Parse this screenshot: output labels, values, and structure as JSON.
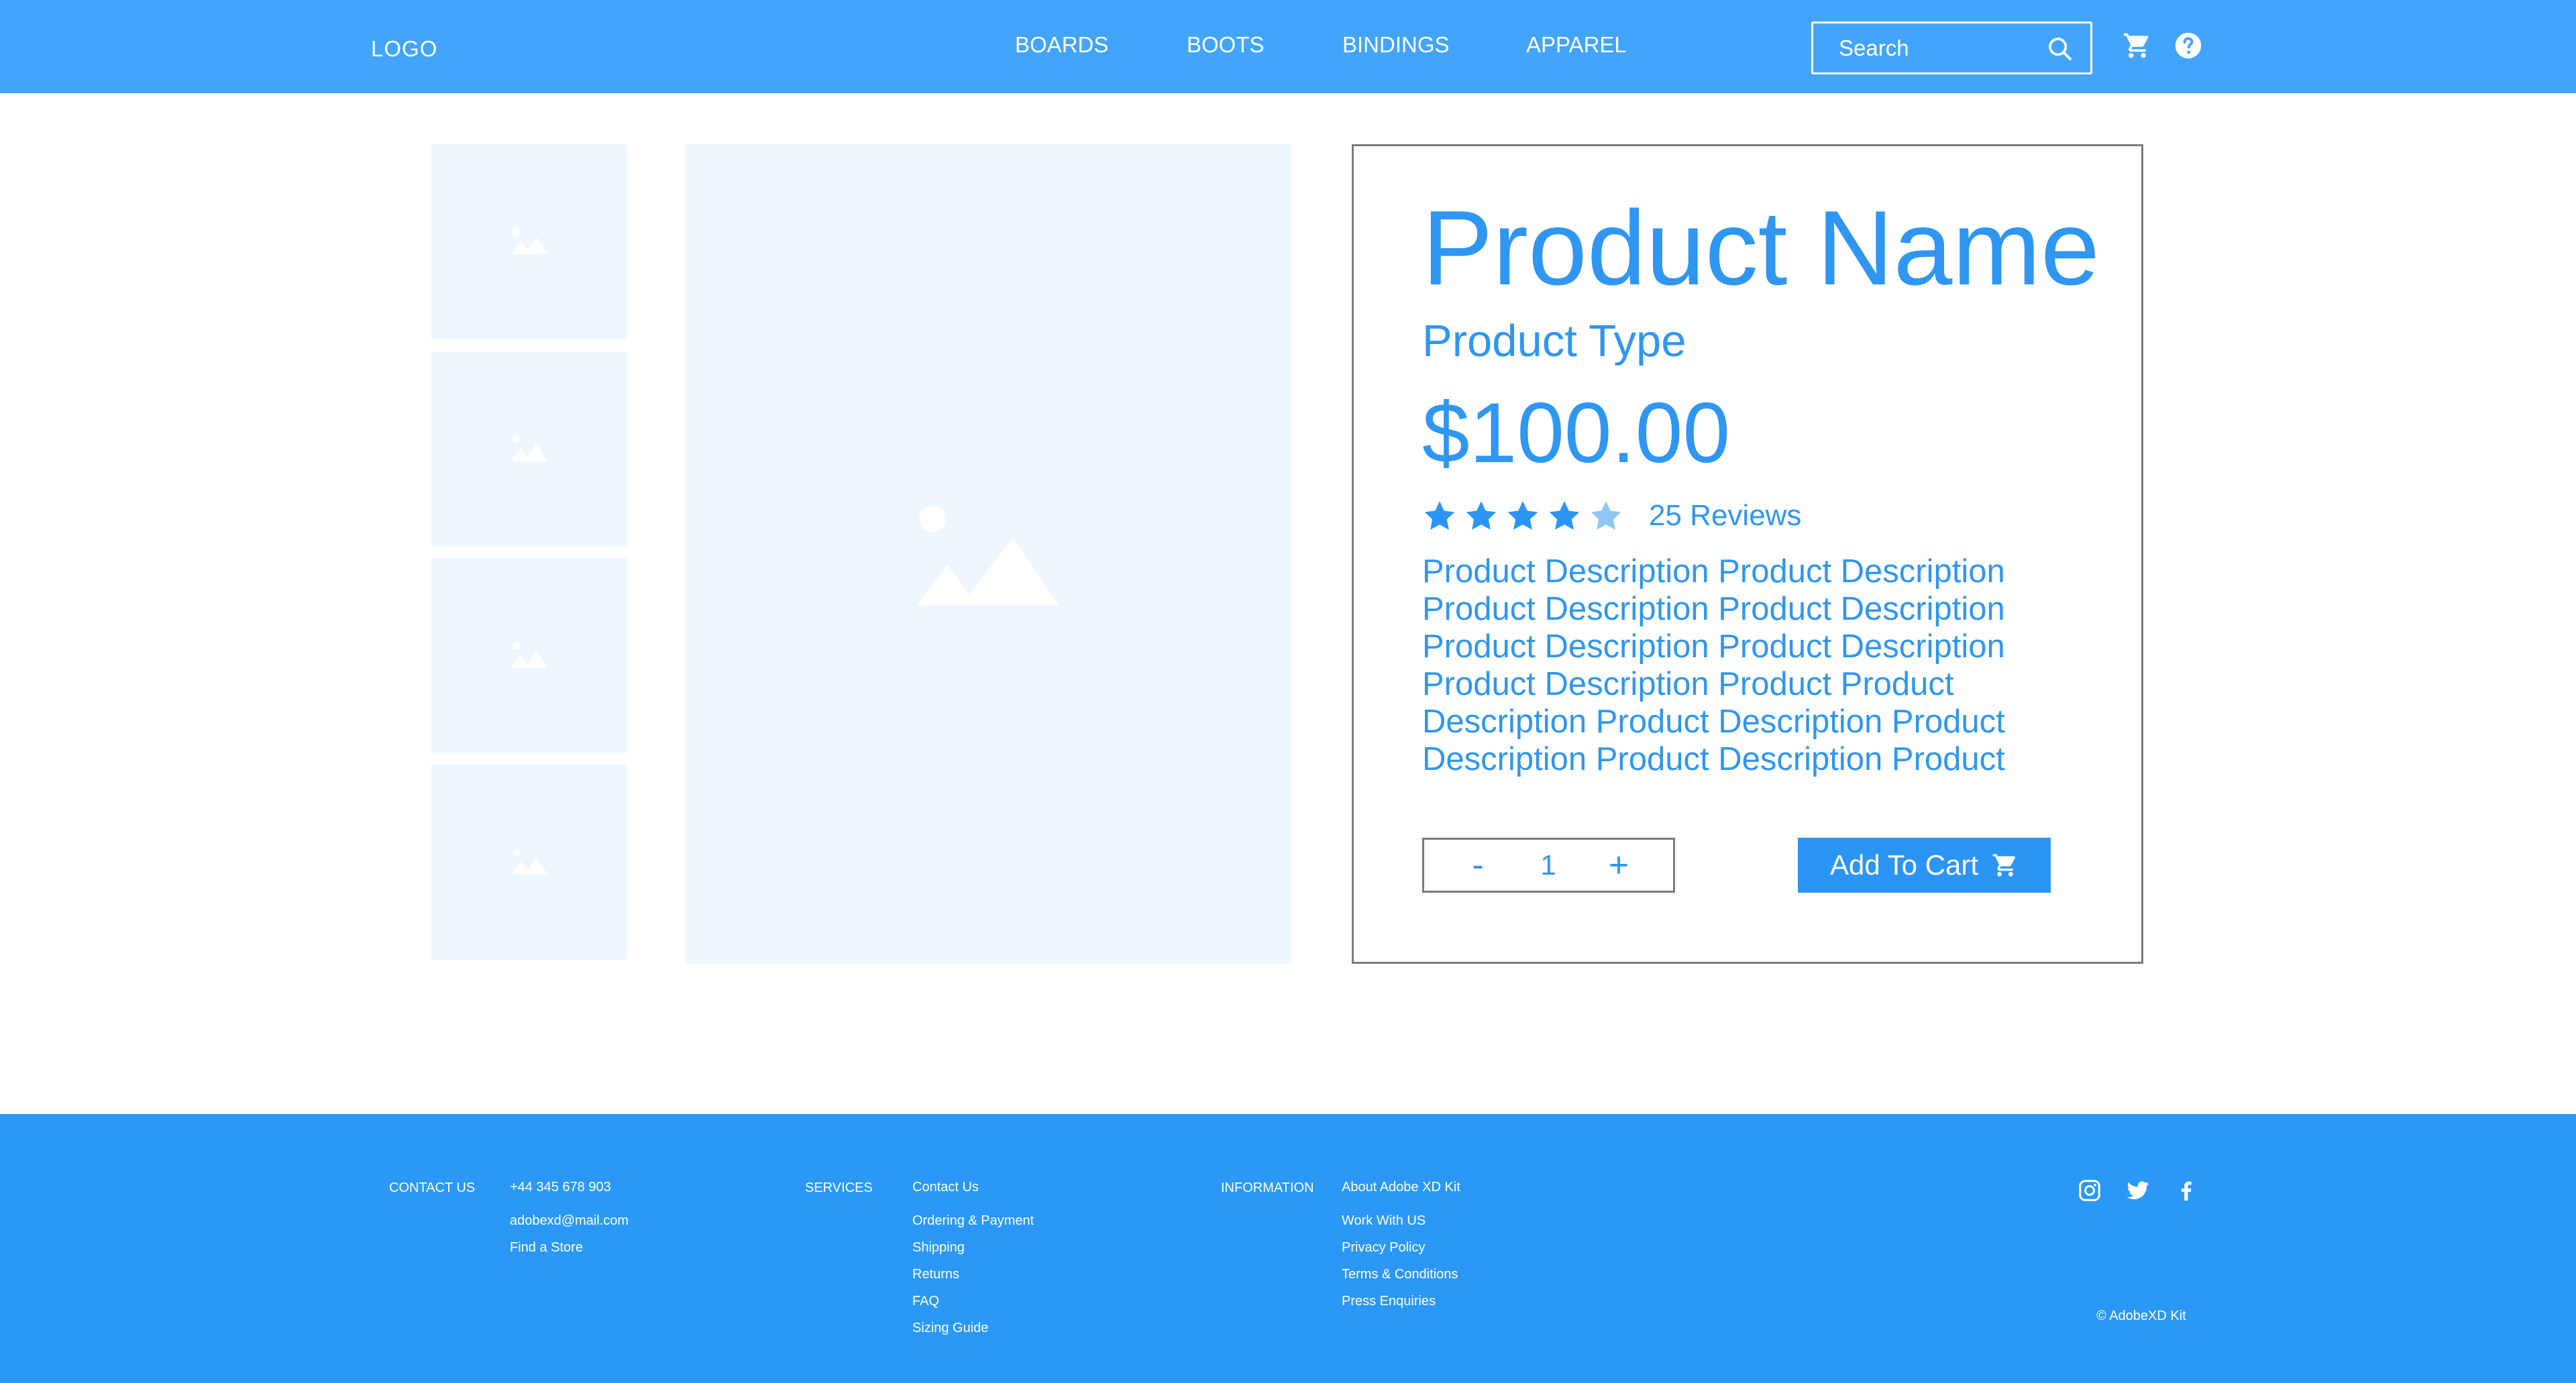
{
  "header": {
    "logo": "LOGO",
    "nav": [
      "BOARDS",
      "BOOTS",
      "BINDINGS",
      "APPAREL"
    ],
    "search_placeholder": "Search",
    "icons": [
      "search-icon",
      "cart-icon",
      "help-icon"
    ]
  },
  "gallery": {
    "thumbnail_count": 4,
    "placeholder_icon": "image-icon"
  },
  "product": {
    "name": "Product Name",
    "type": "Product Type",
    "price": "$100.00",
    "rating": 4,
    "rating_max": 5,
    "reviews_label": "25 Reviews",
    "description": "Product Description Product Description Product Description Product Description Product Description Product Description Product Description Product Product Description Product Description Product Description Product Description Product",
    "quantity": {
      "minus": "-",
      "value": "1",
      "plus": "+"
    },
    "add_to_cart_label": "Add To Cart"
  },
  "colors": {
    "header_bg": "#42a5fb",
    "footer_bg": "#2b98f7",
    "accent": "#2f96f2",
    "placeholder_bg": "#eff7fe",
    "star_filled": "#2b95f5",
    "star_empty": "#8ec6f7"
  },
  "footer": {
    "contact": {
      "heading": "CONTACT US",
      "items": [
        "+44 345 678 903",
        "adobexd@mail.com",
        "Find a Store"
      ]
    },
    "services": {
      "heading": "SERVICES",
      "items": [
        "Contact Us",
        "Ordering & Payment",
        "Shipping",
        "Returns",
        "FAQ",
        "Sizing Guide"
      ]
    },
    "information": {
      "heading": "INFORMATION",
      "items": [
        "About Adobe XD Kit",
        "Work With US",
        "Privacy Policy",
        "Terms & Conditions",
        "Press Enquiries"
      ]
    },
    "social": [
      "instagram-icon",
      "twitter-icon",
      "facebook-icon"
    ],
    "copyright": "© AdobeXD Kit"
  }
}
